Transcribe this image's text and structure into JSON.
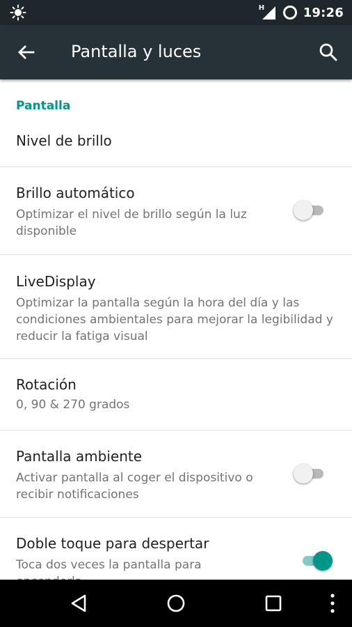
{
  "status_bar": {
    "network_type": "H",
    "time": "19:26"
  },
  "app_bar": {
    "title": "Pantalla y luces",
    "back_icon": "arrow-left-icon",
    "search_icon": "search-icon",
    "color": "#263238"
  },
  "accent_color": "#009688",
  "section": {
    "header": "Pantalla"
  },
  "settings": [
    {
      "title": "Nivel de brillo"
    },
    {
      "title": "Brillo automático",
      "summary": "Optimizar el nivel de brillo según la luz disponible",
      "switch": "off"
    },
    {
      "title": "LiveDisplay",
      "summary": "Optimizar la pantalla según la hora del día y las condiciones ambientales para mejorar la legibilidad y reducir la fatiga visual"
    },
    {
      "title": "Rotación",
      "summary": "0, 90 & 270 grados"
    },
    {
      "title": "Pantalla ambiente",
      "summary": "Activar pantalla al coger el dispositivo o recibir notificaciones",
      "switch": "off"
    },
    {
      "title": "Doble toque para despertar",
      "summary": "Toca dos veces la pantalla para encenderla",
      "switch": "on"
    }
  ],
  "nav_bar": {
    "icons": [
      "back-triangle-icon",
      "home-circle-icon",
      "recents-square-icon",
      "overflow-menu-icon"
    ]
  }
}
